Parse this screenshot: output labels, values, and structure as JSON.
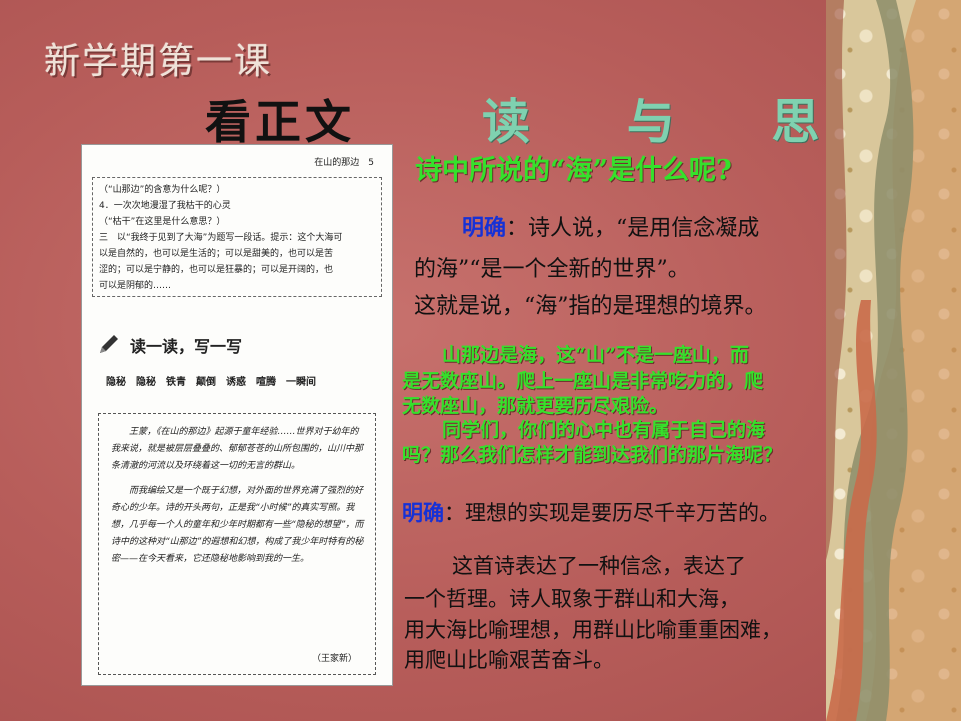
{
  "slide": {
    "title": "新学期第一课",
    "subtitle": "看正文",
    "heading": "读 与 思",
    "question": "诗中所说的“海”是什么呢?",
    "answer1": {
      "label": "明确",
      "line1": "：诗人说，“是用信念凝成",
      "line2": "的海”“是一个全新的世界”。",
      "line3": "这就是说，“海”指的是理想的境界。"
    },
    "green_para": [
      "山那边是海，这“山”不是一座山，而",
      "是无数座山。爬上一座山是非常吃力的，爬",
      "无数座山，那就更要历尽艰险。",
      "同学们，你们的心中也有属于自己的海",
      "吗？那么我们怎样才能到达我们的那片海呢？"
    ],
    "answer2": {
      "label": "明确",
      "text": "：理想的实现是要历尽千辛万苦的。"
    },
    "summary": [
      "这首诗表达了一种信念，表达了",
      "一个哲理。诗人取象于群山和大海，",
      "用大海比喻理想，用群山比喻重重困难，",
      "用爬山比喻艰苦奋斗。"
    ]
  },
  "book": {
    "header": "在山的那边　5",
    "questions": [
      "（“山那边”的含意为什么呢？）",
      "4．一次次地漫湿了我枯干的心灵",
      "（“枯干”在这里是什么意思？）",
      "三　以“我终于见到了大海”为题写一段话。提示：这个大海可",
      "以是自然的，也可以是生活的；可以是甜美的，也可以是苦",
      "涩的；可以是宁静的，也可以是狂暴的；可以是开阔的，也",
      "可以是阴郁的……"
    ],
    "section_title": "读一读，写一写",
    "words": "隐秘　隐秘　铁青　颠倒　诱惑　喧腾　一瞬间",
    "note_paras": [
      "王蒙，《在山的那边》起源于童年经验……世界对于幼年的我来说，就是被层层叠叠的、郁郁苍苍的山所包围的，山川中那条清澈的河流以及环绕着这一切的无言的群山。",
      "而我编绘又是一个既于幻想，对外面的世界充满了强烈的好奇心的少年。诗的开头两句，正是我“小时候”的真实写照。我想，几乎每一个人的童年和少年时期都有一些“隐秘的想望”，而诗中的这种对“山那边”的遐想和幻想，构成了我少年时特有的秘密——在今天看来，它还隐秘地影响到我的一生。"
    ],
    "signature": "（王家新）"
  }
}
